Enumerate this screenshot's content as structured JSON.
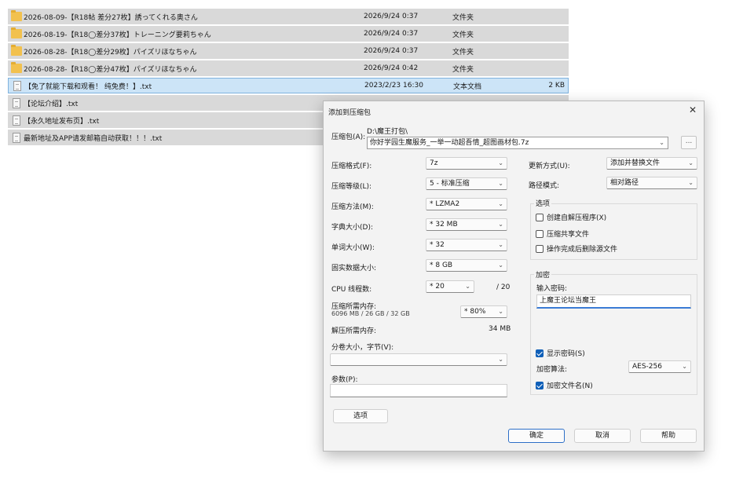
{
  "file_list": [
    {
      "kind": "folder",
      "icon": "folder-icon",
      "name": "2026-08-09-【R18帖 差分27枚】誘ってくれる奥さん",
      "date": "2026/9/24 0:37",
      "type": "文件夹",
      "size": ""
    },
    {
      "kind": "folder",
      "icon": "folder-icon",
      "name": "2026-08-19-【R18◯差分37枚】トレーニング要莉ちゃん",
      "date": "2026/9/24 0:37",
      "type": "文件夹",
      "size": ""
    },
    {
      "kind": "folder",
      "icon": "folder-icon",
      "name": "2026-08-28-【R18◯差分29枚】パイズリほなちゃん",
      "date": "2026/9/24 0:37",
      "type": "文件夹",
      "size": ""
    },
    {
      "kind": "folder",
      "icon": "folder-icon",
      "name": "2026-08-28-【R18◯差分47枚】パイズリほなちゃん",
      "date": "2026/9/24 0:42",
      "type": "文件夹",
      "size": ""
    },
    {
      "kind": "text",
      "icon": "txt-file-icon",
      "name": "【免了就能下载和观看！ 纯免费！】.txt",
      "date": "2023/2/23 16:30",
      "type": "文本文档",
      "size": "2 KB"
    },
    {
      "kind": "text",
      "icon": "txt-file-icon",
      "name": "【论坛介绍】.txt",
      "date": "",
      "type": "",
      "size": ""
    },
    {
      "kind": "text",
      "icon": "txt-file-icon",
      "name": "【永久地址发布页】.txt",
      "date": "",
      "type": "",
      "size": ""
    },
    {
      "kind": "text",
      "icon": "txt-file-icon",
      "name": "最新地址及APP请发邮箱自动获取！！！.txt",
      "date": "",
      "type": "",
      "size": ""
    }
  ],
  "dialog": {
    "title": "添加到压缩包",
    "archive_label": "压缩包(A):",
    "archive_path": "D:\\魔王打包\\",
    "archive_name": "你好学园生魔服务_一举一动超吾情_超图画材包.7z",
    "browse_label": "...",
    "left_fields": [
      {
        "label": "压缩格式(F):",
        "value": "7z"
      },
      {
        "label": "压缩等级(L):",
        "value": "5 - 标准压缩"
      },
      {
        "label": "压缩方法(M):",
        "value": "* LZMA2"
      },
      {
        "label": "字典大小(D):",
        "value": "* 32 MB"
      },
      {
        "label": "单词大小(W):",
        "value": "* 32"
      },
      {
        "label": "固实数据大小:",
        "value": "* 8 GB"
      },
      {
        "label": "CPU 线程数:",
        "value": "* 20"
      }
    ],
    "cpu_total": "/ 20",
    "memory_label": "压缩所需内存:",
    "memory_detail": "6096 MB / 26 GB / 32 GB",
    "memory_value": "* 80%",
    "decompress_label": "解压所需内存:",
    "decompress_value": "34 MB",
    "split_label": "分卷大小，字节(V):",
    "split_value": "",
    "params_label": "参数(P):",
    "params_value": "",
    "options_button": "选项",
    "update_label": "更新方式(U):",
    "update_value": "添加并替换文件",
    "path_label": "路径模式:",
    "path_value": "相对路径",
    "options_group": {
      "title": "选项",
      "items": [
        {
          "label": "创建自解压程序(X)",
          "checked": false
        },
        {
          "label": "压缩共享文件",
          "checked": false
        },
        {
          "label": "操作完成后删除源文件",
          "checked": false
        }
      ]
    },
    "encryption_group": {
      "title": "加密",
      "password_label": "输入密码:",
      "password_value": "上魔王论坛当魔王",
      "show_password": {
        "label": "显示密码(S)",
        "checked": true
      },
      "method_label": "加密算法:",
      "method_value": "AES-256",
      "encrypt_names": {
        "label": "加密文件名(N)",
        "checked": true
      }
    },
    "ok_button": "确定",
    "cancel_button": "取消",
    "help_button": "帮助"
  }
}
